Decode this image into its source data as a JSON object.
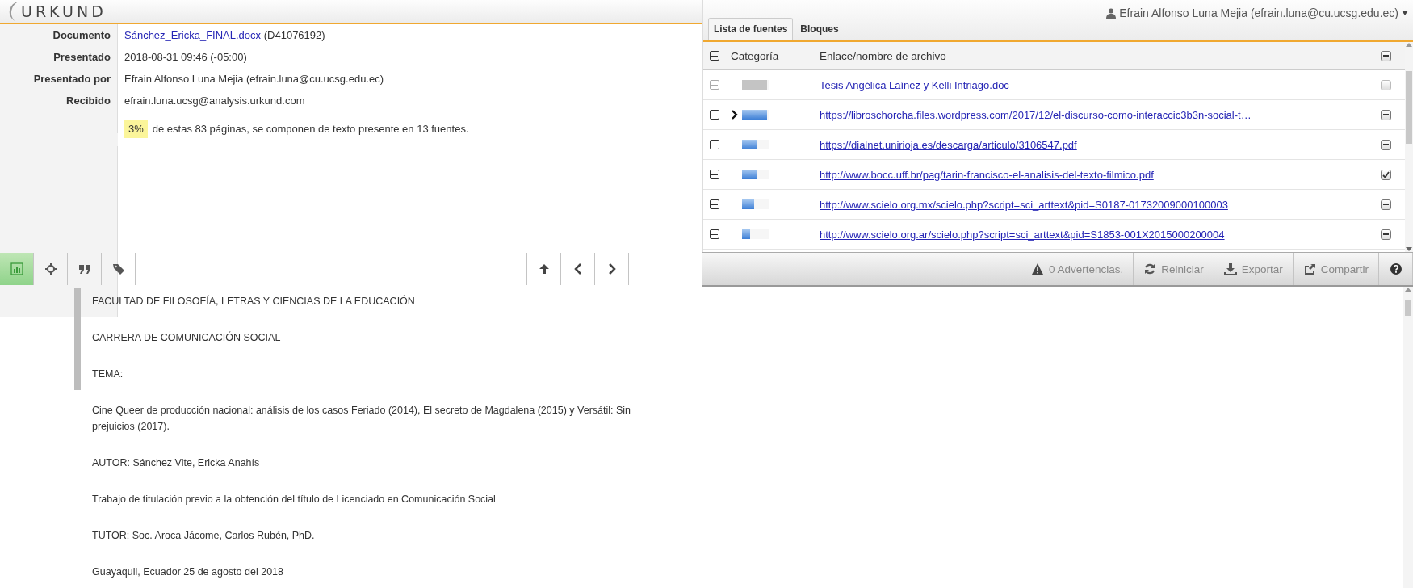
{
  "header": {
    "logo": "URKUND",
    "user_menu": "Efrain Alfonso Luna Mejia (efrain.luna@cu.ucsg.edu.ec)"
  },
  "details": [
    {
      "label": "Documento",
      "link": "Sánchez_Ericka_FINAL.docx",
      "value": "(D41076192)"
    },
    {
      "label": "Presentado",
      "value": "2018-08-31 09:46 (-05:00)"
    },
    {
      "label": "Presentado por",
      "value": "Efrain Alfonso Luna Mejia (efrain.luna@cu.ucsg.edu.ec)"
    },
    {
      "label": "Recibido",
      "value": "efrain.luna.ucsg@analysis.urkund.com"
    }
  ],
  "summary": {
    "percent": "3%",
    "text": "de estas 83 páginas, se componen de texto presente en 13 fuentes."
  },
  "tabs": [
    {
      "label": "Lista de fuentes",
      "selected": true
    },
    {
      "label": "Bloques",
      "selected": false
    }
  ],
  "sources": {
    "columns": [
      "Categoría",
      "Enlace/nombre de archivo"
    ],
    "select_all": {
      "checked": true,
      "partial": true
    },
    "rows": [
      {
        "link": "Tesis Angélica Laínez y Kelli Intriago.doc",
        "level": 0.9,
        "greyed": true,
        "current": false,
        "checked": false,
        "partial": false
      },
      {
        "link": "https://libroschorcha.files.wordpress.com/2017/12/el-discurso-como-interaccic3b3n-social-t…",
        "level": 0.9,
        "greyed": false,
        "current": true,
        "checked": true,
        "partial": true
      },
      {
        "link": "https://dialnet.unirioja.es/descarga/articulo/3106547.pdf",
        "level": 0.55,
        "greyed": false,
        "current": false,
        "checked": true,
        "partial": true
      },
      {
        "link": "http://www.bocc.uff.br/pag/tarin-francisco-el-analisis-del-texto-filmico.pdf",
        "level": 0.55,
        "greyed": false,
        "current": false,
        "checked": true,
        "partial": false
      },
      {
        "link": "http://www.scielo.org.mx/scielo.php?script=sci_arttext&pid=S0187-01732009000100003",
        "level": 0.45,
        "greyed": false,
        "current": false,
        "checked": true,
        "partial": true
      },
      {
        "link": "http://www.scielo.org.ar/scielo.php?script=sci_arttext&pid=S1853-001X2015000200004",
        "level": 0.3,
        "greyed": false,
        "current": false,
        "checked": true,
        "partial": true
      }
    ]
  },
  "toolbar": {
    "left": [
      {
        "kind": "chart",
        "selected": true
      },
      {
        "kind": "crosshair",
        "selected": false
      },
      {
        "kind": "quote",
        "selected": false
      },
      {
        "kind": "tag",
        "selected": false
      }
    ],
    "nav": [
      {
        "kind": "up"
      },
      {
        "kind": "prev"
      },
      {
        "kind": "next"
      }
    ],
    "right": [
      {
        "kind": "warning",
        "label": "0 Advertencias."
      },
      {
        "kind": "restart",
        "label": "Reiniciar"
      },
      {
        "kind": "export",
        "label": "Exportar"
      },
      {
        "kind": "share",
        "label": "Compartir"
      },
      {
        "kind": "help"
      }
    ]
  },
  "document": {
    "paragraphs": [
      "FACULTAD DE FILOSOFÍA, LETRAS Y CIENCIAS DE LA EDUCACIÓN",
      "CARRERA DE COMUNICACIÓN SOCIAL",
      "TEMA:",
      "Cine Queer de producción nacional: análisis de los casos Feriado (2014), El secreto de Magdalena (2015) y Versátil: Sin prejuicios (2017).",
      "AUTOR: Sánchez Vite, Ericka Anahís",
      "Trabajo de titulación previo a la obtención del título de Licenciado en Comunicación Social",
      "TUTOR: Soc. Aroca Jácome, Carlos Rubén, PhD.",
      "Guayaquil, Ecuador 25 de agosto del 2018"
    ]
  }
}
